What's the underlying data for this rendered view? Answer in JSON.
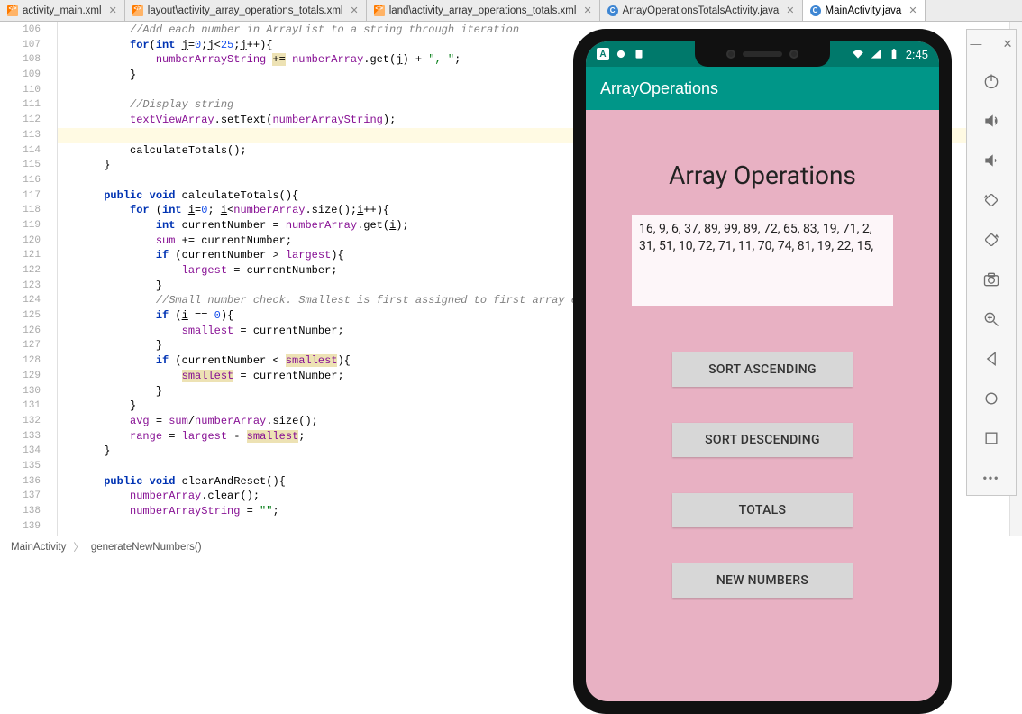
{
  "tabs": [
    {
      "label": "activity_main.xml",
      "type": "xml",
      "active": false
    },
    {
      "label": "layout\\activity_array_operations_totals.xml",
      "type": "xml",
      "active": false
    },
    {
      "label": "land\\activity_array_operations_totals.xml",
      "type": "xml",
      "active": false
    },
    {
      "label": "ArrayOperationsTotalsActivity.java",
      "type": "java",
      "active": false
    },
    {
      "label": "MainActivity.java",
      "type": "java",
      "active": true
    }
  ],
  "gutter": {
    "start": 106,
    "end": 139
  },
  "code_lines": [
    {
      "t": "cm",
      "txt": "          //Add each number in ArrayList to a string through iteration"
    },
    {
      "t": "p",
      "html": "          <span class=kw>for</span>(<span class=kw>int</span> <u>j</u>=<span class=num>0</span>;<u>j</u>&lt;<span class=num>25</span>;<u>j</u>++){"
    },
    {
      "t": "p",
      "html": "              <span class=fld>numberArrayString</span> <span class=yel>+=</span> <span class=fld>numberArray</span>.get(<u>j</u>) + <span class=str>\", \"</span>;"
    },
    {
      "t": "p",
      "html": "          }"
    },
    {
      "t": "p",
      "html": ""
    },
    {
      "t": "cm",
      "txt": "          //Display string"
    },
    {
      "t": "p",
      "html": "          <span class=fld>textViewArray</span>.setText(<span class=fld>numberArrayString</span>);"
    },
    {
      "t": "p",
      "html": "",
      "hl": true
    },
    {
      "t": "p",
      "html": "          calculateTotals();"
    },
    {
      "t": "p",
      "html": "      }"
    },
    {
      "t": "p",
      "html": ""
    },
    {
      "t": "p",
      "html": "      <span class=kw>public void</span> calculateTotals(){"
    },
    {
      "t": "p",
      "html": "          <span class=kw>for</span> (<span class=kw>int</span> <u>i</u>=<span class=num>0</span>; <u>i</u>&lt;<span class=fld>numberArray</span>.size();<u>i</u>++){"
    },
    {
      "t": "p",
      "html": "              <span class=kw>int</span> currentNumber = <span class=fld>numberArray</span>.get(<u>i</u>);"
    },
    {
      "t": "p",
      "html": "              <span class=fld>sum</span> += currentNumber;"
    },
    {
      "t": "p",
      "html": "              <span class=kw>if</span> (currentNumber &gt; <span class=fld>largest</span>){"
    },
    {
      "t": "p",
      "html": "                  <span class=fld>largest</span> = currentNumber;"
    },
    {
      "t": "p",
      "html": "              }"
    },
    {
      "t": "cm",
      "txt": "              //Small number check. Smallest is first assigned to first array elem"
    },
    {
      "t": "p",
      "html": "              <span class=kw>if</span> (<u>i</u> == <span class=num>0</span>){"
    },
    {
      "t": "p",
      "html": "                  <span class=fld>smallest</span> = currentNumber;"
    },
    {
      "t": "p",
      "html": "              }"
    },
    {
      "t": "p",
      "html": "              <span class=kw>if</span> (currentNumber &lt; <span class=yel><span class=fld>smallest</span></span>){"
    },
    {
      "t": "p",
      "html": "                  <span class=yel><span class=fld>smallest</span></span> = currentNumber;"
    },
    {
      "t": "p",
      "html": "              }"
    },
    {
      "t": "p",
      "html": "          }"
    },
    {
      "t": "p",
      "html": "          <span class=fld>avg</span> = <span class=fld>sum</span>/<span class=fld>numberArray</span>.size();"
    },
    {
      "t": "p",
      "html": "          <span class=fld>range</span> = <span class=fld>largest</span> - <span class=yel><span class=fld>smallest</span></span>;"
    },
    {
      "t": "p",
      "html": "      }"
    },
    {
      "t": "p",
      "html": ""
    },
    {
      "t": "p",
      "html": "      <span class=kw>public void</span> clearAndReset(){"
    },
    {
      "t": "p",
      "html": "          <span class=fld>numberArray</span>.clear();"
    },
    {
      "t": "p",
      "html": "          <span class=fld>numberArrayString</span> = <span class=str>\"\"</span>;"
    }
  ],
  "breadcrumb": [
    "MainActivity",
    "generateNewNumbers()"
  ],
  "emulator": {
    "status_left_icon": "A",
    "status_time": "2:45",
    "appbar": "ArrayOperations",
    "heading": "Array Operations",
    "numbers": "16, 9, 6, 37, 89, 99, 89, 72, 65, 83, 19, 71, 2, 31, 51, 10, 72, 71, 11, 70, 74, 81, 19, 22, 15,",
    "buttons": [
      "SORT ASCENDING",
      "SORT DESCENDING",
      "TOTALS",
      "NEW NUMBERS"
    ]
  },
  "tool_icons": [
    "power",
    "volume-up",
    "volume-down",
    "rotate-left",
    "rotate-right",
    "camera",
    "zoom",
    "back",
    "home",
    "overview",
    "more"
  ]
}
